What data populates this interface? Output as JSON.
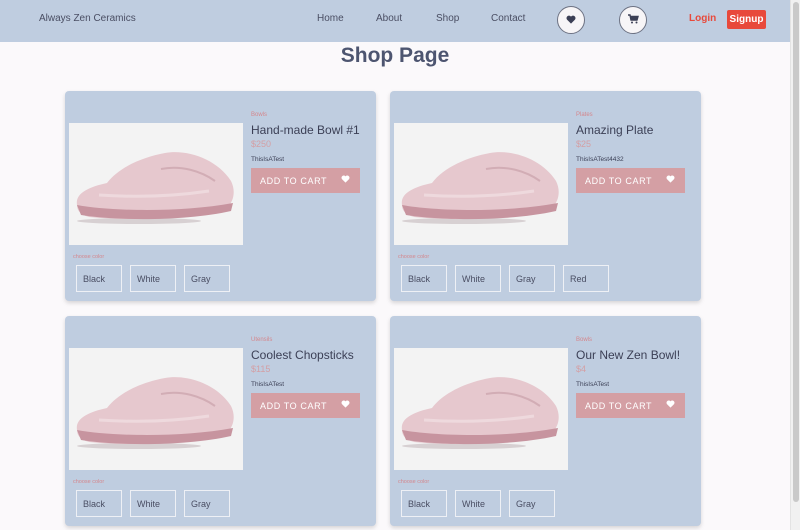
{
  "nav": {
    "brand": "Always Zen Ceramics",
    "links": [
      "Home",
      "About",
      "Shop",
      "Contact"
    ],
    "login": "Login",
    "signup": "Signup"
  },
  "page_title": "Shop Page",
  "products": [
    {
      "category": "Bowls",
      "name": "Hand-made Bowl #1",
      "price": "$250",
      "description": "ThisIsATest",
      "button": "ADD TO CART",
      "choose_label": "choose color",
      "colors": [
        "Black",
        "White",
        "Gray"
      ]
    },
    {
      "category": "Plates",
      "name": "Amazing Plate",
      "price": "$25",
      "description": "ThisIsATest4432",
      "button": "ADD TO CART",
      "choose_label": "choose color",
      "colors": [
        "Black",
        "White",
        "Gray",
        "Red"
      ]
    },
    {
      "category": "Utensils",
      "name": "Coolest Chopsticks",
      "price": "$115",
      "description": "ThisIsATest",
      "button": "ADD TO CART",
      "choose_label": "choose color",
      "colors": [
        "Black",
        "White",
        "Gray"
      ]
    },
    {
      "category": "Bowls",
      "name": "Our New Zen Bowl!",
      "price": "$4",
      "description": "ThisIsATest",
      "button": "ADD TO CART",
      "choose_label": "choose color",
      "colors": [
        "Black",
        "White",
        "Gray"
      ]
    }
  ],
  "colors": {
    "navbar": "#bfcde0",
    "accent": "#e8493b",
    "cart_button": "#d49fa4",
    "category_text": "#d4878d"
  }
}
